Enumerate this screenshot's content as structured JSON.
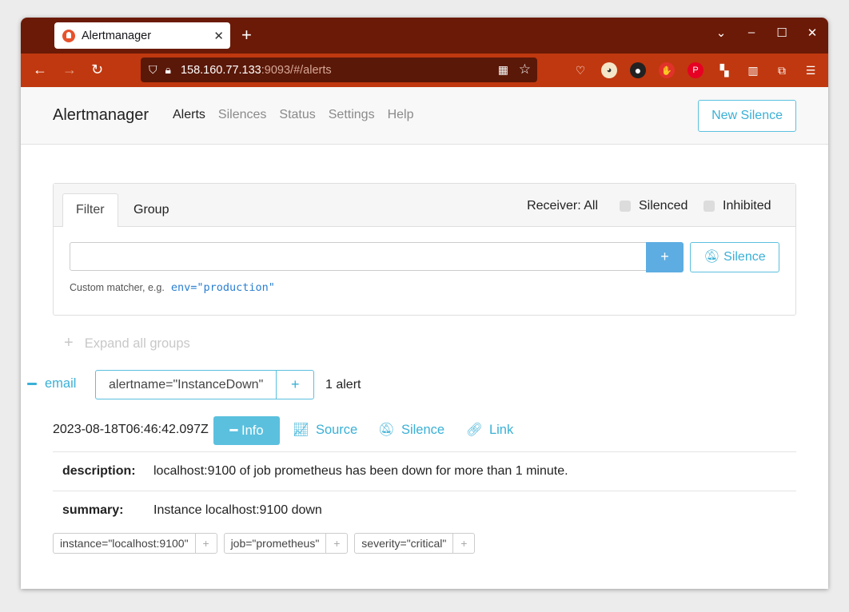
{
  "browser": {
    "tab_title": "Alertmanager",
    "url_host": "158.160.77.133",
    "url_rest": ":9093/#/alerts"
  },
  "app": {
    "brand": "Alertmanager",
    "nav": [
      "Alerts",
      "Silences",
      "Status",
      "Settings",
      "Help"
    ],
    "new_silence": "New Silence"
  },
  "filter": {
    "tabs": [
      "Filter",
      "Group"
    ],
    "receiver": "Receiver: All",
    "silenced": "Silenced",
    "inhibited": "Inhibited",
    "input_value": "",
    "plus": "+",
    "silence_button": "Silence",
    "hint": "Custom matcher, e.g.",
    "hint_example": "env=\"production\""
  },
  "expand_all": "Expand all groups",
  "group": {
    "receiver": "email",
    "matcher": "alertname=\"InstanceDown\"",
    "plus": "+",
    "count": "1 alert"
  },
  "alert": {
    "timestamp": "2023-08-18T06:46:42.097Z",
    "info": "Info",
    "source": "Source",
    "silence": "Silence",
    "link": "Link",
    "annotations": [
      {
        "key": "description:",
        "value": "localhost:9100 of job prometheus has been down for more than 1 minute."
      },
      {
        "key": "summary:",
        "value": "Instance localhost:9100 down"
      }
    ],
    "labels": [
      "instance=\"localhost:9100\"",
      "job=\"prometheus\"",
      "severity=\"critical\""
    ]
  }
}
